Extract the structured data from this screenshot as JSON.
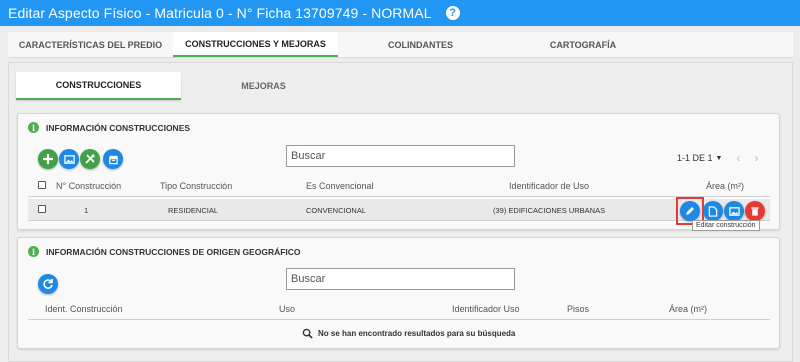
{
  "window": {
    "title": "Editar Aspecto Físico - Matricula 0 - N° Ficha 13709749 - NORMAL",
    "help_symbol": "?"
  },
  "top_tabs": [
    {
      "label": "CARACTERÍSTICAS DEL PREDIO",
      "active": false
    },
    {
      "label": "CONSTRUCCIONES Y MEJORAS",
      "active": true
    },
    {
      "label": "COLINDANTES",
      "active": false
    },
    {
      "label": "CARTOGRAFÍA",
      "active": false
    }
  ],
  "sub_tabs": [
    {
      "label": "CONSTRUCCIONES",
      "active": true
    },
    {
      "label": "MEJORAS",
      "active": false
    }
  ],
  "construcciones": {
    "header": "INFORMACIÓN CONSTRUCCIONES",
    "search_placeholder": "Buscar",
    "pager_text": "1-1 DE 1",
    "columns": [
      "N° Construcción",
      "Tipo Construcción",
      "Es Convencional",
      "Identificador de Uso",
      "Área (m²)"
    ],
    "rows": [
      {
        "numero": "1",
        "tipo": "RESIDENCIAL",
        "convencional": "CONVENCIONAL",
        "identificador": "(39) EDIFICACIONES URBANAS",
        "area": ""
      }
    ],
    "toolbar_icons": [
      "add-icon",
      "image-icon",
      "tools-icon",
      "archive-icon"
    ],
    "row_action_icons": [
      "edit-icon",
      "document-icon",
      "image-icon",
      "delete-icon"
    ],
    "tooltip": "Editar construcción"
  },
  "origen_geografico": {
    "header": "INFORMACIÓN CONSTRUCCIONES DE ORIGEN GEOGRÁFICO",
    "search_placeholder": "Buscar",
    "columns": [
      "Ident. Construcción",
      "Uso",
      "Identificador Uso",
      "Pisos",
      "Área (m²)"
    ],
    "empty_message": "No se han encontrado resultados para su búsqueda"
  },
  "colors": {
    "primary": "#2196f3",
    "success": "#43a047",
    "danger": "#e53935",
    "active_tab_underline": "#4caf50"
  }
}
